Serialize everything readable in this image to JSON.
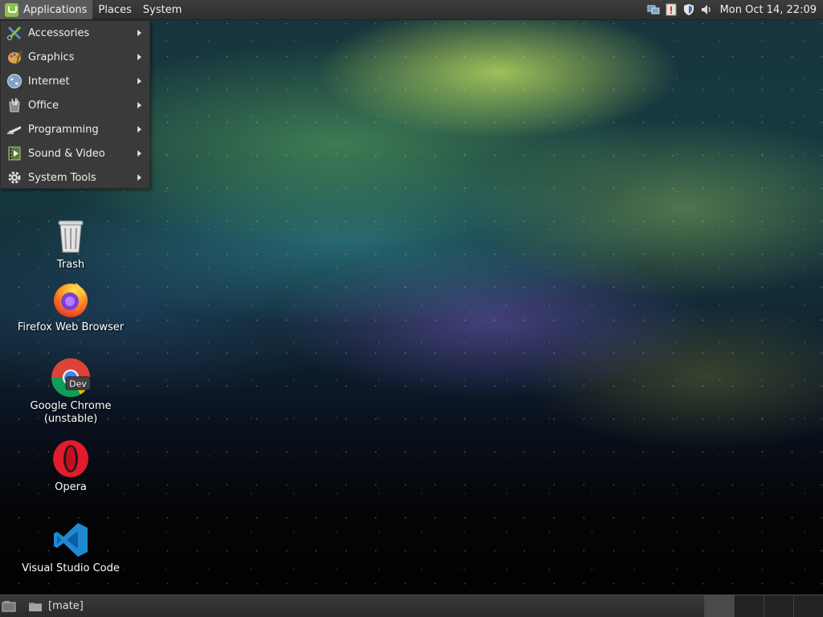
{
  "top_panel": {
    "menus": [
      {
        "label": "Applications"
      },
      {
        "label": "Places"
      },
      {
        "label": "System"
      }
    ],
    "tray_icons": [
      "network-icon",
      "update-manager-icon",
      "shield-icon",
      "volume-icon"
    ],
    "clock": "Mon Oct 14, 22:09"
  },
  "applications_menu": {
    "items": [
      {
        "label": "Accessories",
        "icon": "accessories-icon"
      },
      {
        "label": "Graphics",
        "icon": "graphics-icon"
      },
      {
        "label": "Internet",
        "icon": "internet-icon"
      },
      {
        "label": "Office",
        "icon": "office-icon"
      },
      {
        "label": "Programming",
        "icon": "programming-icon"
      },
      {
        "label": "Sound & Video",
        "icon": "sound-video-icon"
      },
      {
        "label": "System Tools",
        "icon": "system-tools-icon"
      }
    ]
  },
  "desktop": {
    "icons": [
      {
        "label": "Trash",
        "icon": "trash-icon"
      },
      {
        "label": "Firefox Web Browser",
        "icon": "firefox-icon"
      },
      {
        "label": "Google Chrome (unstable)",
        "icon": "chrome-dev-icon",
        "badge": "Dev"
      },
      {
        "label": "Opera",
        "icon": "opera-icon"
      },
      {
        "label": "Visual Studio Code",
        "icon": "vscode-icon"
      }
    ]
  },
  "bottom_panel": {
    "task_label": "[mate]",
    "workspace_count": 4,
    "active_workspace": 1
  },
  "colors": {
    "panel_bg": "#2e2e2e",
    "menu_bg": "#3a3a3a",
    "mint_green": "#8fc24a"
  }
}
